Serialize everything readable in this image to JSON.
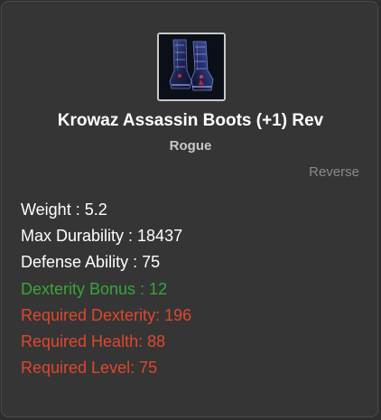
{
  "item": {
    "icon": "assassin-boots-icon",
    "name": "Krowaz Assassin Boots (+1) Rev",
    "class": "Rogue",
    "tag": "Reverse"
  },
  "stats": [
    {
      "text": "Weight : 5.2",
      "kind": "normal"
    },
    {
      "text": "Max Durability : 18437",
      "kind": "normal"
    },
    {
      "text": "Defense Ability : 75",
      "kind": "normal"
    },
    {
      "text": "Dexterity Bonus : 12",
      "kind": "bonus"
    },
    {
      "text": "Required Dexterity: 196",
      "kind": "required"
    },
    {
      "text": "Required Health: 88",
      "kind": "required"
    },
    {
      "text": "Required Level: 75",
      "kind": "required"
    }
  ],
  "colors": {
    "panel_bg": "#353535",
    "name": "#ffffff",
    "class": "#c8c8c8",
    "tag": "#8a8a8a",
    "normal": "#ffffff",
    "bonus": "#3aa53a",
    "required": "#e0472f"
  }
}
